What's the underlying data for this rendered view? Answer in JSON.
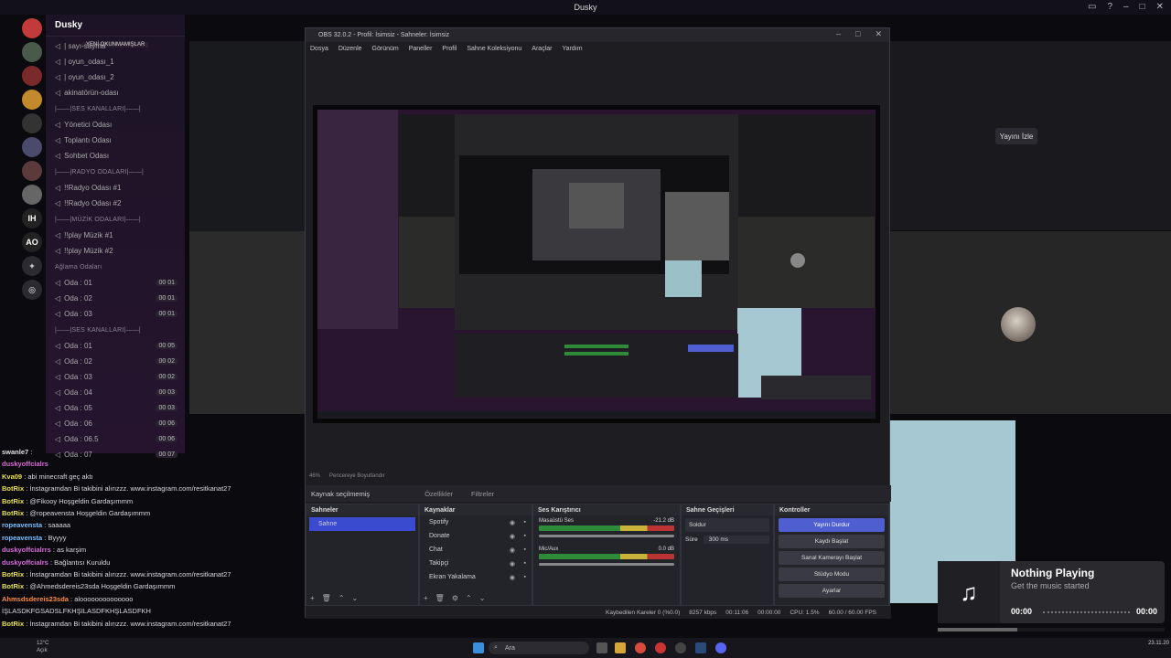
{
  "window_title": "Dusky",
  "server": {
    "name": "Dusky",
    "unread_banner": "YENİ OKUNMAMIŞLAR",
    "items": [
      {
        "type": "ch",
        "label": "| sayı-sayma"
      },
      {
        "type": "ch",
        "label": "| oyun_odası_1"
      },
      {
        "type": "ch",
        "label": "| oyun_odası_2"
      },
      {
        "type": "ch",
        "label": "akinatörün-odası"
      },
      {
        "type": "cat",
        "label": "|——|SES KANALLARI|——|"
      },
      {
        "type": "ch",
        "label": "Yönetici Odası"
      },
      {
        "type": "ch",
        "label": "Toplantı Odası"
      },
      {
        "type": "ch",
        "label": "Sohbet Odası"
      },
      {
        "type": "cat",
        "label": "|——|RADYO ODALARI|——|"
      },
      {
        "type": "ch",
        "label": "!!Radyo Odası #1"
      },
      {
        "type": "ch",
        "label": "!!Radyo Odası #2"
      },
      {
        "type": "cat",
        "label": "|——|MÜZİK ODALARI|——|"
      },
      {
        "type": "ch",
        "label": "!!play Müzik #1"
      },
      {
        "type": "ch",
        "label": "!!play Müzik #2"
      },
      {
        "type": "cat",
        "label": "Ağlama Odaları"
      },
      {
        "type": "ch",
        "label": "Oda : 01",
        "count": "00 01"
      },
      {
        "type": "ch",
        "label": "Oda : 02",
        "count": "00 01"
      },
      {
        "type": "ch",
        "label": "Oda : 03",
        "count": "00 01"
      },
      {
        "type": "cat",
        "label": "|——|SES KANALLARI|——|"
      },
      {
        "type": "ch",
        "label": "Oda : 01",
        "count": "00 05"
      },
      {
        "type": "ch",
        "label": "Oda : 02",
        "count": "00 02"
      },
      {
        "type": "ch",
        "label": "Oda : 03",
        "count": "00 02"
      },
      {
        "type": "ch",
        "label": "Oda : 04",
        "count": "00 03"
      },
      {
        "type": "ch",
        "label": "Oda : 05",
        "count": "00 03"
      },
      {
        "type": "ch",
        "label": "Oda : 06",
        "count": "00 06"
      },
      {
        "type": "ch",
        "label": "Oda : 06.5",
        "count": "00 06"
      },
      {
        "type": "ch",
        "label": "Oda : 07",
        "count": "00 07"
      }
    ]
  },
  "chat": [
    {
      "user": "swanle7",
      "msg": " :",
      "color": "#e0e0e0"
    },
    {
      "user": "duskyoffcialrs",
      "msg": "",
      "color": "#d76cd8"
    },
    {
      "user": "Kva09",
      "msg": " : abi minecraft geç aktı",
      "color": "#e8e050"
    },
    {
      "user": "BotRix",
      "msg": " : İnstagramdan Bi takibini alırızzz. www.instagram.com/resitkanat27",
      "color": "#e8e050"
    },
    {
      "user": "BotRix",
      "msg": " : @Fikooy Hoşgeldin Gardaşımmm",
      "color": "#e8e050"
    },
    {
      "user": "BotRix",
      "msg": " : @ropeavensta Hoşgeldin Gardaşımmm",
      "color": "#e8e050"
    },
    {
      "user": "ropeavensta",
      "msg": " : saaaaa",
      "color": "#7ac0ff"
    },
    {
      "user": "ropeavensta",
      "msg": " : Byyyy",
      "color": "#7ac0ff"
    },
    {
      "user": "duskyoffcialrrs",
      "msg": " : as karşim",
      "color": "#d76cd8"
    },
    {
      "user": "duskyoffcialrs",
      "msg": " : Bağlantısı Kuruldu",
      "color": "#d76cd8"
    },
    {
      "user": "BotRix",
      "msg": " : İnstagramdan Bi takibini alırızzz. www.instagram.com/resitkanat27",
      "color": "#e8e050"
    },
    {
      "user": "BotRix",
      "msg": " : @Ahmedsdereis23sda Hoşgeldin Gardaşımmm",
      "color": "#e8e050"
    },
    {
      "user": "Ahmsdsdereis23sda",
      "msg": " : aloooooooooooooo",
      "color": "#ff8c3a"
    },
    {
      "user": "",
      "msg": "İŞLASDKFGSADSLFKHŞILASDFKHŞLASDFKH",
      "color": "#ffffff"
    },
    {
      "user": "BotRix",
      "msg": " : İnstagramdan Bi takibini alırızzz. www.instagram.com/resitkanat27",
      "color": "#e8e050"
    }
  ],
  "obs": {
    "title": "OBS 32.0.2 - Profil: İsimsiz - Sahneler: İsimsiz",
    "menu": [
      "Dosya",
      "Düzenle",
      "Görünüm",
      "Paneller",
      "Profil",
      "Sahne Koleksiyonu",
      "Araçlar",
      "Yardım"
    ],
    "zoom": "46%",
    "zoom_mode": "Pencereye Boyutlandır",
    "source_label": "Kaynak seçilmemiş",
    "props": "Özellikler",
    "filters": "Filtreler",
    "docks": {
      "scenes": "Sahneler",
      "sources": "Kaynaklar",
      "mixer": "Ses Karıştırıcı",
      "transitions": "Sahne Geçişleri",
      "controls": "Kontroller"
    },
    "scene_items": [
      "Sahne"
    ],
    "source_items": [
      "Spotify",
      "Donate",
      "Chat",
      "Takipçi",
      "Ekran Yakalama"
    ],
    "mixer": [
      {
        "name": "Masaüstü Ses",
        "db": "-21.2 dB"
      },
      {
        "name": "Mic/Aux",
        "db": "0.0 dB"
      }
    ],
    "transition": {
      "type": "Soldur",
      "duration_label": "Süre",
      "duration": "300 ms"
    },
    "controls": [
      "Yayını Durdur",
      "Kaydı Başlat",
      "Sanal Kamerayı Başlat",
      "Stüdyo Modu",
      "Ayarlar"
    ],
    "status": {
      "dropped": "Kaybedilen Kareler 0 (%0.0)",
      "kbps": "8257 kbps",
      "live": "00:11:06",
      "rec": "00:00:00",
      "cpu": "CPU: 1.5%",
      "fps": "60.00 / 60.00 FPS"
    }
  },
  "watch_stream": "Yayını İzle",
  "music": {
    "title": "Nothing Playing",
    "subtitle": "Get the music started",
    "time_start": "00:00",
    "time_end": "00:00"
  },
  "taskbar": {
    "search": "Ara",
    "weather_temp": "12°C",
    "weather_desc": "Açık",
    "date": "23.11.20"
  }
}
